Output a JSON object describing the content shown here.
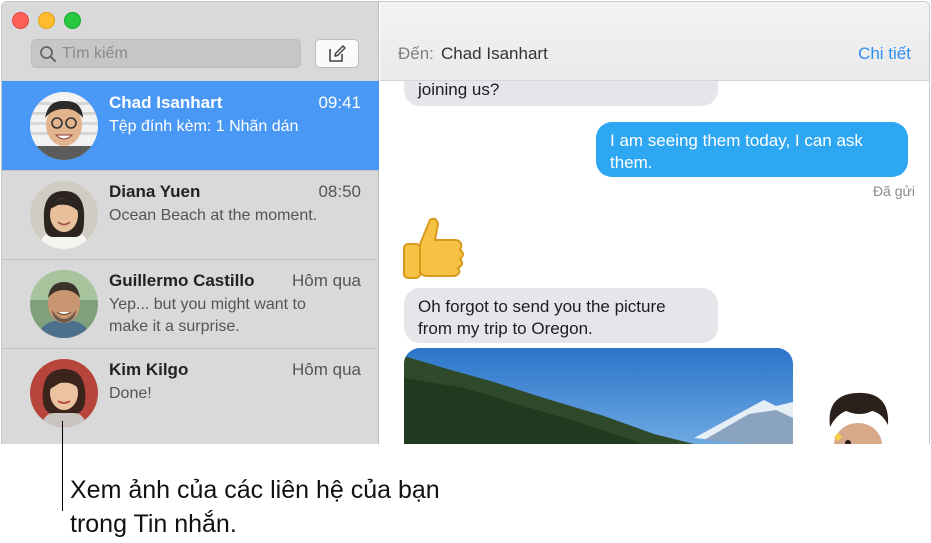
{
  "sidebar": {
    "search": {
      "placeholder": "Tìm kiếm",
      "icon": "search-icon"
    },
    "compose_icon": "compose-icon",
    "conversations": [
      {
        "name": "Chad Isanhart",
        "time": "09:41",
        "preview": "Tệp đính kèm: 1 Nhãn dán",
        "selected": true
      },
      {
        "name": "Diana Yuen",
        "time": "08:50",
        "preview": "Ocean Beach at the moment.",
        "selected": false
      },
      {
        "name": "Guillermo Castillo",
        "time": "Hôm qua",
        "preview": "Yep... but you might want to make it a surprise.",
        "selected": false
      },
      {
        "name": "Kim Kilgo",
        "time": "Hôm qua",
        "preview": "Done!",
        "selected": false
      }
    ]
  },
  "chat": {
    "to_label": "Đến:",
    "to_name": "Chad Isanhart",
    "details_label": "Chi tiết",
    "messages": [
      {
        "direction": "in",
        "text": "joining us?"
      },
      {
        "direction": "out",
        "text": "I am seeing them today, I can ask them."
      },
      {
        "direction": "in",
        "text": "Oh forgot to send you the picture from my trip to Oregon."
      }
    ],
    "delivered_label": "Đã gửi"
  },
  "caption": "Xem ảnh của các liên hệ của bạn trong Tin nhắn.",
  "colors": {
    "selection": "#4a98f5",
    "outgoing_bubble": "#2ea7f2",
    "incoming_bubble": "#e5e5ea",
    "link": "#2e8ff2"
  }
}
